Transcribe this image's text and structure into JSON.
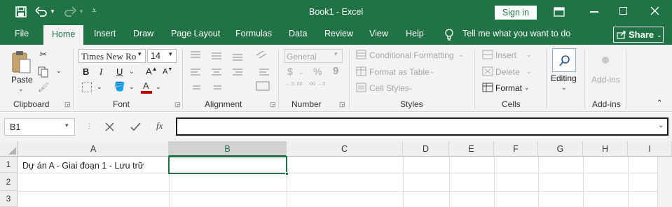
{
  "window": {
    "title": "Book1 - Excel",
    "sign_in": "Sign in",
    "qat": {
      "save_icon": "save-icon",
      "undo_icon": "undo-icon",
      "redo_icon": "redo-icon",
      "customize_icon": "customize-qat-icon"
    }
  },
  "tabs": [
    {
      "label": "File"
    },
    {
      "label": "Home"
    },
    {
      "label": "Insert"
    },
    {
      "label": "Draw"
    },
    {
      "label": "Page Layout"
    },
    {
      "label": "Formulas"
    },
    {
      "label": "Data"
    },
    {
      "label": "Review"
    },
    {
      "label": "View"
    },
    {
      "label": "Help"
    }
  ],
  "tell_me": "Tell me what you want to do",
  "share": "Share",
  "ribbon": {
    "clipboard": {
      "paste": "Paste",
      "label": "Clipboard"
    },
    "font": {
      "name": "Times New Roman",
      "size": "14",
      "bold": "B",
      "italic": "I",
      "underline": "U",
      "label": "Font"
    },
    "alignment": {
      "label": "Alignment"
    },
    "number": {
      "format": "General",
      "currency": "$",
      "percent": "%",
      "comma": "9",
      "inc": "←.0 .00",
      "dec": ".00 →.0",
      "label": "Number"
    },
    "styles": {
      "conditional": "Conditional Formatting",
      "table": "Format as Table",
      "cell": "Cell Styles",
      "label": "Styles"
    },
    "cells": {
      "insert": "Insert",
      "delete": "Delete",
      "format": "Format",
      "label": "Cells"
    },
    "editing": {
      "label": "Editing"
    },
    "addins": {
      "label": "Add-ins",
      "group": "Add-ins"
    }
  },
  "formula_bar": {
    "name_box": "B1",
    "fx": "fx",
    "value": ""
  },
  "columns": [
    "A",
    "B",
    "C",
    "D",
    "E",
    "F",
    "G",
    "H",
    "I"
  ],
  "rows": [
    "1",
    "2",
    "3"
  ],
  "cells": {
    "A1": "Dự án A - Giai đoạn 1 - Lưu trữ"
  },
  "selected": "B1",
  "colors": {
    "brand": "#217346",
    "accent_red": "#c00000"
  }
}
